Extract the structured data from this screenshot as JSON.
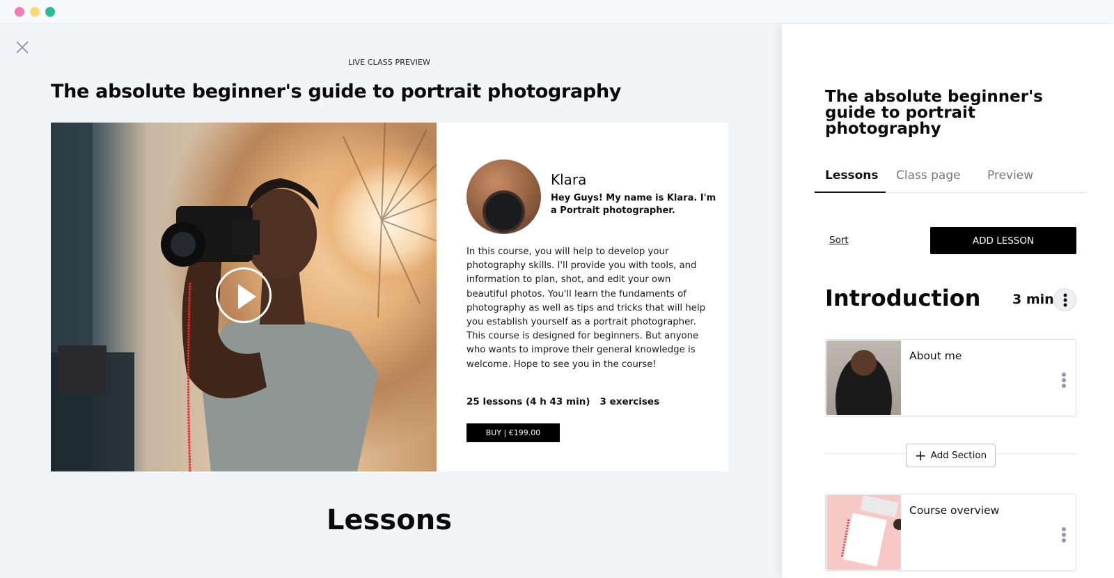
{
  "window": {
    "controls": [
      "close",
      "minimize",
      "maximize"
    ]
  },
  "main": {
    "close_icon": "close-icon",
    "preview_label": "LIVE CLASS PREVIEW",
    "course_title": "The absolute beginner's guide to portrait photography",
    "hero": {
      "play_icon": "play-icon",
      "instructor": {
        "name": "Klara",
        "bio": "Hey Guys! My name is Klara. I'm a Portrait photographer."
      },
      "description": "In this course, you will help to develop your photography skills. I'll provide you with tools, and information to plan, shot, and edit your own beautiful photos. You'll learn the fundaments of photography as well as tips and tricks that will help you establish yourself as a portrait photographer. This course is designed for beginners. But anyone who wants to improve their general knowledge is welcome. Hope to see you in the course!",
      "lessons_count": "25 lessons (4 h 43 min)",
      "exercises_count": "3 exercises",
      "buy_label": "BUY | €199.00"
    },
    "lessons_heading": "Lessons"
  },
  "sidebar": {
    "title": "The absolute beginner's guide to portrait photography",
    "tabs": [
      {
        "label": "Lessons",
        "active": true
      },
      {
        "label": "Class page",
        "active": false
      },
      {
        "label": "Preview",
        "active": false
      }
    ],
    "sort_label": "Sort",
    "add_lesson_label": "ADD LESSON",
    "section": {
      "title": "Introduction",
      "duration": "3 min"
    },
    "lessons": [
      {
        "title": "About me"
      },
      {
        "title": "Course overview"
      }
    ],
    "add_section_label": "Add Section"
  }
}
